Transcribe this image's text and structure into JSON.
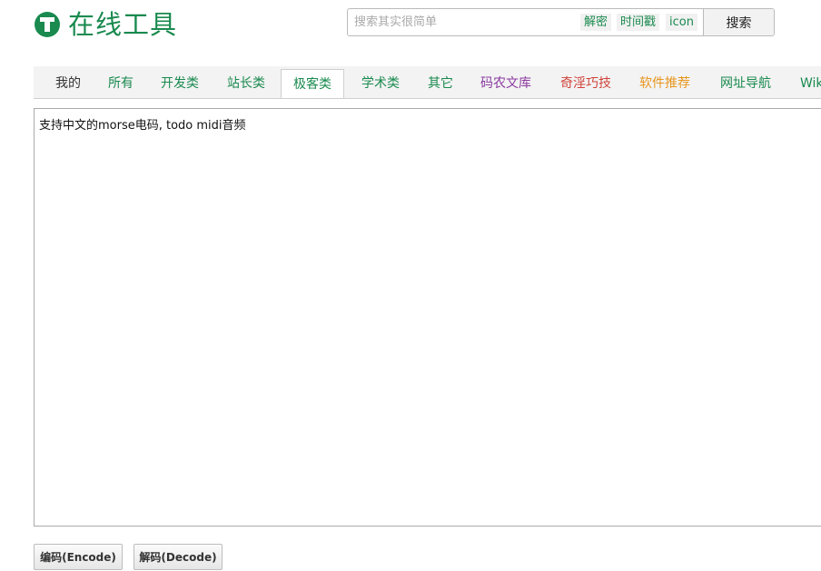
{
  "header": {
    "logo_text": "在线工具",
    "search": {
      "placeholder": "搜索其实很简单",
      "value": "",
      "quick_links": [
        "解密",
        "时间戳",
        "icon"
      ],
      "button_label": "搜索"
    }
  },
  "tabs": [
    {
      "label": "我的",
      "color": "#333333"
    },
    {
      "label": "所有",
      "color": "#1a8a4f"
    },
    {
      "label": "开发类",
      "color": "#1a8a4f"
    },
    {
      "label": "站长类",
      "color": "#1a8a4f"
    },
    {
      "label": "极客类",
      "color": "#1a8a4f",
      "active": true
    },
    {
      "label": "学术类",
      "color": "#1a8a4f"
    },
    {
      "label": "其它",
      "color": "#1a8a4f"
    },
    {
      "label": "码农文库",
      "color": "#8b3aa0"
    },
    {
      "label": "奇淫巧技",
      "color": "#d0433a"
    },
    {
      "label": "软件推荐",
      "color": "#e8961e"
    },
    {
      "label": "网址导航",
      "color": "#1a8a4f"
    },
    {
      "label": "Wik",
      "color": "#1a8a4f"
    }
  ],
  "editor": {
    "text": "支持中文的morse电码, todo midi音频"
  },
  "actions": {
    "encode_label": "编码(Encode)",
    "decode_label": "解码(Decode)"
  },
  "colors": {
    "brand": "#1a8a4f"
  }
}
